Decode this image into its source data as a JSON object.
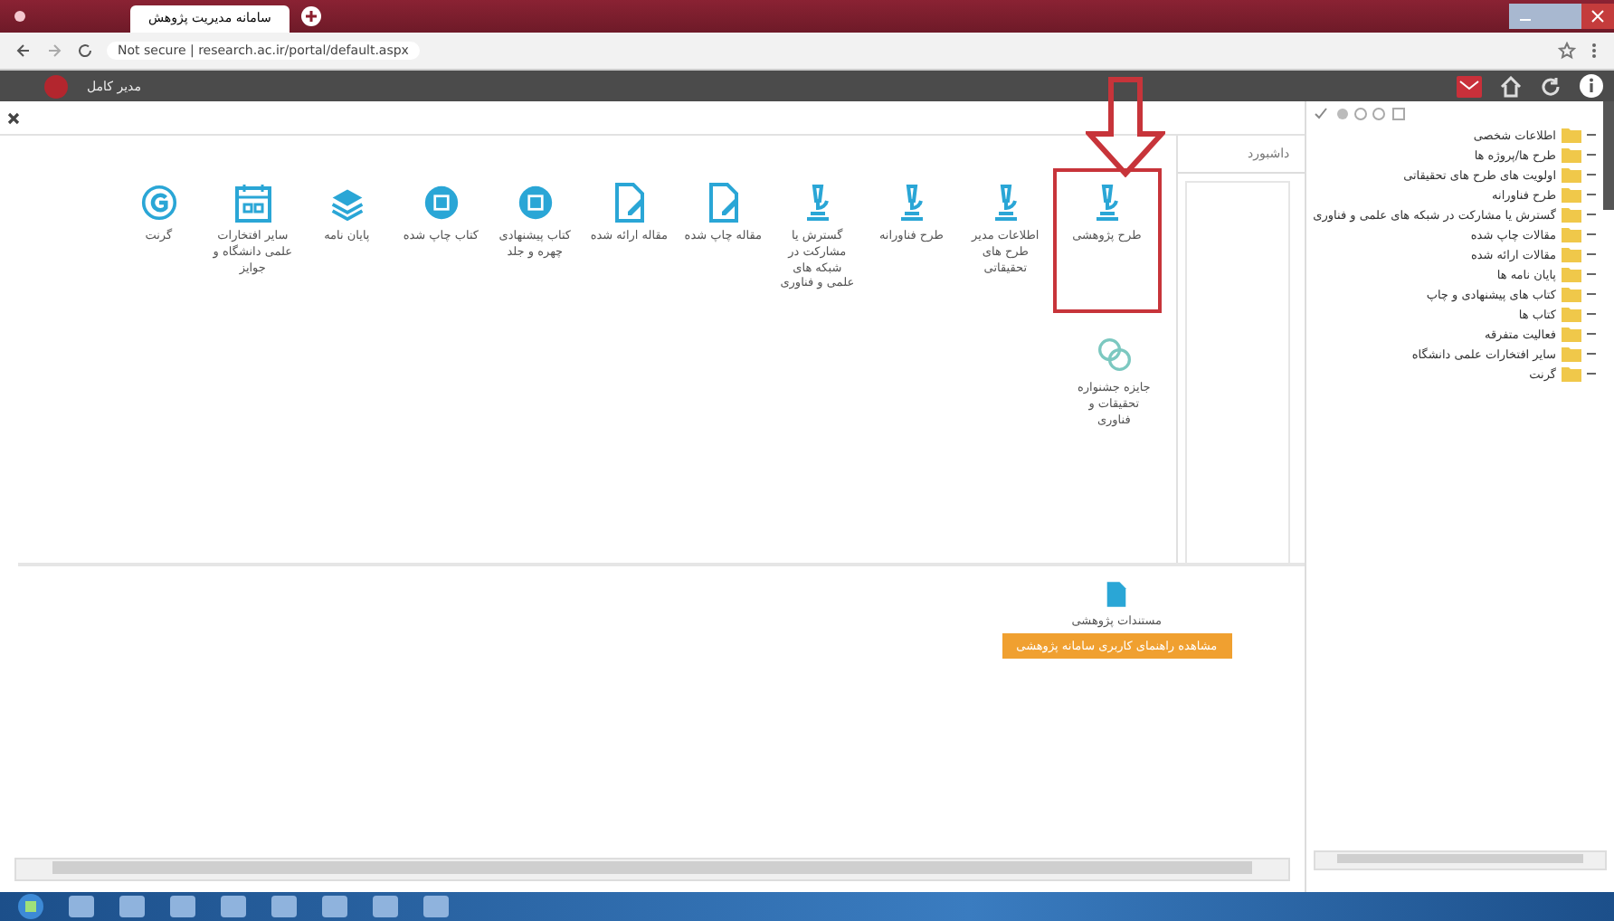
{
  "browser": {
    "tab_title": "سامانه مدیریت پژوهش",
    "address": "Not secure | research.ac.ir/portal/default.aspx"
  },
  "app_header": {
    "user": "مدیر کامل"
  },
  "panel_tab": {
    "label": "داشبورد"
  },
  "modules": [
    {
      "label": "طرح پژوهشی",
      "kind": "microscope",
      "selected": true
    },
    {
      "label": "اطلاعات مدیر طرح های تحقیقاتی",
      "kind": "microscope",
      "selected": false
    },
    {
      "label": "طرح فناورانه",
      "kind": "microscope",
      "selected": false
    },
    {
      "label": "گسترش یا مشارکت در شبکه های علمی و فناوری",
      "kind": "microscope",
      "selected": false
    },
    {
      "label": "مقاله چاپ شده",
      "kind": "document",
      "selected": false
    },
    {
      "label": "مقاله ارائه شده",
      "kind": "document",
      "selected": false
    },
    {
      "label": "کتاب پیشنهادی چهره و جلد",
      "kind": "disc",
      "selected": false
    },
    {
      "label": "کتاب چاپ شده",
      "kind": "disc",
      "selected": false
    },
    {
      "label": "پایان نامه",
      "kind": "stack",
      "selected": false
    },
    {
      "label": "سایر افتخارات علمی دانشگاه و جوایز",
      "kind": "calendar",
      "selected": false
    },
    {
      "label": "گرنت",
      "kind": "grant",
      "selected": false
    },
    {
      "label": "جایزه جشنواره تحقیقات و فناوری",
      "kind": "award",
      "selected": false
    }
  ],
  "documents": {
    "label": "مستندات پژوهشی",
    "button": "مشاهده راهنمای کاربری سامانه پژوهشی"
  },
  "tree": [
    {
      "label": "اطلاعات شخصی"
    },
    {
      "label": "طرح ها/پروژه ها"
    },
    {
      "label": "اولویت های طرح های تحقیقاتی"
    },
    {
      "label": "طرح فناورانه"
    },
    {
      "label": "گسترش یا مشارکت در شبکه های علمی و فناوری"
    },
    {
      "label": "مقالات چاپ شده"
    },
    {
      "label": "مقالات ارائه شده"
    },
    {
      "label": "پایان نامه ها"
    },
    {
      "label": "کتاب های پیشنهادی و چاپ"
    },
    {
      "label": "کتاب ها"
    },
    {
      "label": "فعالیت متفرقه"
    },
    {
      "label": "سایر افتخارات علمی دانشگاه"
    },
    {
      "label": "گرنت"
    }
  ]
}
